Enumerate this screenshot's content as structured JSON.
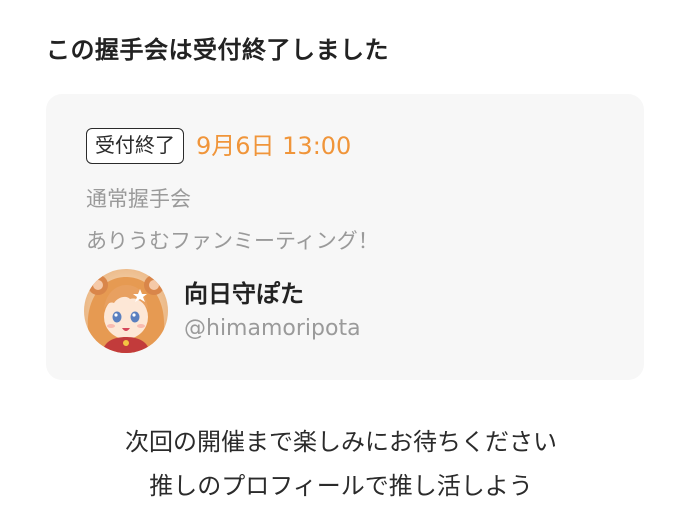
{
  "heading": "この握手会は受付終了しました",
  "card": {
    "status_badge": "受付終了",
    "datetime": "9月6日 13:00",
    "event_type": "通常握手会",
    "event_description": "ありうむファンミーティング！",
    "talent": {
      "name": "向日守ぽた",
      "handle": "@himamoripota"
    }
  },
  "footer": {
    "line1": "次回の開催まで楽しみにお待ちください",
    "line2": "推しのプロフィールで推し活しよう"
  },
  "colors": {
    "accent_orange": "#f0953a",
    "muted_gray": "#9a9a9a",
    "card_bg": "#f7f7f7"
  }
}
